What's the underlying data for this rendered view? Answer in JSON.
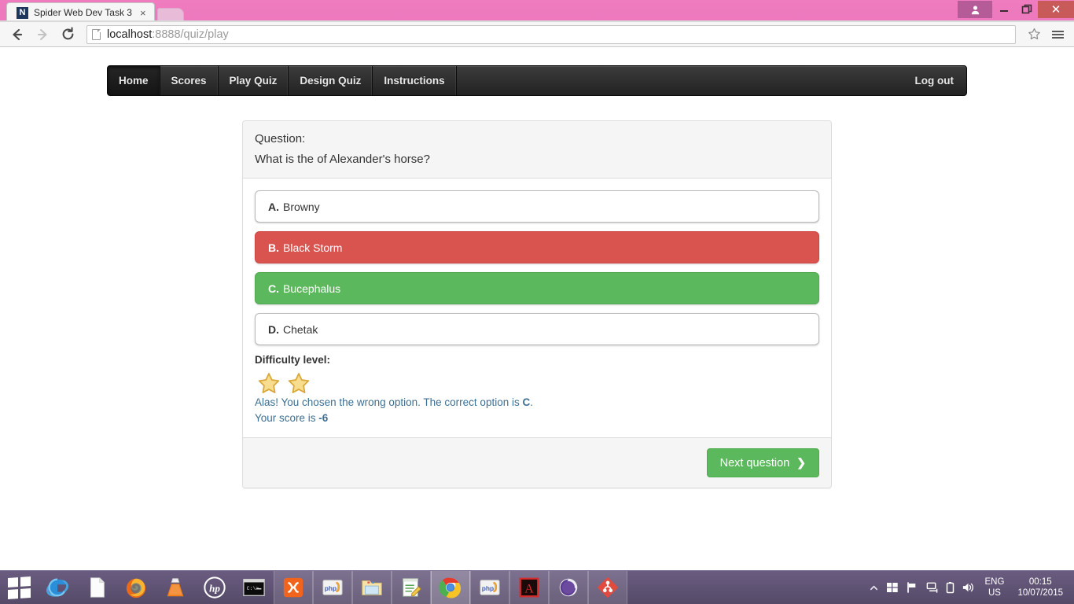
{
  "browser": {
    "tab": {
      "title": "Spider Web Dev Task 3",
      "favicon_letter": "N",
      "close_label": "×"
    },
    "new_tab_name": "new-tab",
    "window_controls": {
      "minimize": "–",
      "maximize": "❐",
      "close": "✕"
    },
    "toolbar": {
      "back": "←",
      "forward": "→",
      "reload": "⟳",
      "url_host": "localhost",
      "url_path": ":8888/quiz/play",
      "url_full": "localhost:8888/quiz/play",
      "bookmark": "☆"
    }
  },
  "nav": {
    "items": [
      {
        "label": "Home",
        "active": true
      },
      {
        "label": "Scores",
        "active": false
      },
      {
        "label": "Play Quiz",
        "active": false
      },
      {
        "label": "Design Quiz",
        "active": false
      },
      {
        "label": "Instructions",
        "active": false
      }
    ],
    "logout_label": "Log out"
  },
  "quiz": {
    "question_label": "Question:",
    "question_text": "What is the of Alexander's horse?",
    "options": [
      {
        "letter": "A.",
        "text": "Browny",
        "state": "neutral"
      },
      {
        "letter": "B.",
        "text": "Black Storm",
        "state": "wrong"
      },
      {
        "letter": "C.",
        "text": "Bucephalus",
        "state": "correct"
      },
      {
        "letter": "D.",
        "text": "Chetak",
        "state": "neutral"
      }
    ],
    "difficulty_label": "Difficulty level:",
    "difficulty_stars": 2,
    "feedback_line1_pre": "Alas! You chosen the wrong option. The correct option is ",
    "feedback_line1_bold": "C",
    "feedback_line1_post": ".",
    "feedback_line2_pre": "Your score is ",
    "feedback_line2_bold": "-6",
    "next_button_label": "Next question",
    "next_button_chevron": "❯"
  },
  "colors": {
    "wrong": "#d9534f",
    "correct": "#5cb85c",
    "feedback_text": "#3d6f92",
    "titlebar": "#ef7cbf",
    "taskbar": "#5c4f72",
    "star": "#f7d774"
  },
  "taskbar": {
    "start_name": "windows-start-button",
    "items": [
      {
        "name": "internet-explorer",
        "state": ""
      },
      {
        "name": "document",
        "state": ""
      },
      {
        "name": "firefox",
        "state": ""
      },
      {
        "name": "vlc-media-player",
        "state": ""
      },
      {
        "name": "hp-support",
        "state": ""
      },
      {
        "name": "command-prompt",
        "state": ""
      },
      {
        "name": "xampp",
        "state": "open"
      },
      {
        "name": "phpstorm",
        "state": "open"
      },
      {
        "name": "file-explorer",
        "state": "open"
      },
      {
        "name": "notepad-plus-plus",
        "state": "open"
      },
      {
        "name": "google-chrome",
        "state": "active"
      },
      {
        "name": "phpstorm-2",
        "state": "open"
      },
      {
        "name": "adobe-acrobat",
        "state": "open"
      },
      {
        "name": "pale-moon-browser",
        "state": "open"
      },
      {
        "name": "sourcetree",
        "state": "open"
      }
    ],
    "tray": {
      "show_hidden": "▲",
      "language_line1": "ENG",
      "language_line2": "US",
      "time": "00:15",
      "date": "10/07/2015"
    }
  }
}
